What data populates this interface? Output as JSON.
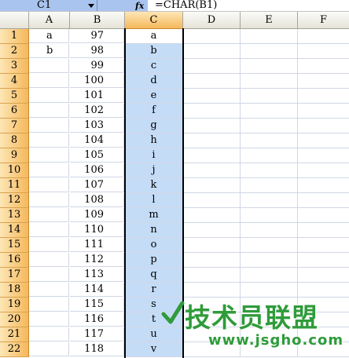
{
  "formula_bar": {
    "name_box": "C1",
    "fx_icon": "fx-icon",
    "formula": "=CHAR(B1)"
  },
  "columns": [
    "A",
    "B",
    "C",
    "D",
    "E",
    "F"
  ],
  "selected_column": "C",
  "rows": [
    {
      "num": "1",
      "a": "a",
      "b": "97",
      "c": "a"
    },
    {
      "num": "2",
      "a": "b",
      "b": "98",
      "c": "b"
    },
    {
      "num": "3",
      "a": "",
      "b": "99",
      "c": "c"
    },
    {
      "num": "4",
      "a": "",
      "b": "100",
      "c": "d"
    },
    {
      "num": "5",
      "a": "",
      "b": "101",
      "c": "e"
    },
    {
      "num": "6",
      "a": "",
      "b": "102",
      "c": "f"
    },
    {
      "num": "7",
      "a": "",
      "b": "103",
      "c": "g"
    },
    {
      "num": "8",
      "a": "",
      "b": "104",
      "c": "h"
    },
    {
      "num": "9",
      "a": "",
      "b": "105",
      "c": "i"
    },
    {
      "num": "10",
      "a": "",
      "b": "106",
      "c": "j"
    },
    {
      "num": "11",
      "a": "",
      "b": "107",
      "c": "k"
    },
    {
      "num": "12",
      "a": "",
      "b": "108",
      "c": "l"
    },
    {
      "num": "13",
      "a": "",
      "b": "109",
      "c": "m"
    },
    {
      "num": "14",
      "a": "",
      "b": "110",
      "c": "n"
    },
    {
      "num": "15",
      "a": "",
      "b": "111",
      "c": "o"
    },
    {
      "num": "16",
      "a": "",
      "b": "112",
      "c": "p"
    },
    {
      "num": "17",
      "a": "",
      "b": "113",
      "c": "q"
    },
    {
      "num": "18",
      "a": "",
      "b": "114",
      "c": "r"
    },
    {
      "num": "19",
      "a": "",
      "b": "115",
      "c": "s"
    },
    {
      "num": "20",
      "a": "",
      "b": "116",
      "c": "t"
    },
    {
      "num": "21",
      "a": "",
      "b": "117",
      "c": "u"
    },
    {
      "num": "22",
      "a": "",
      "b": "118",
      "c": "v"
    }
  ],
  "watermark": {
    "title": "技术员联盟",
    "url": "www.jsgho.com"
  },
  "colors": {
    "selection_fill": "#c5dcf7",
    "header_highlight": "#f5b85c",
    "watermark_green": "#2f9b3a"
  }
}
